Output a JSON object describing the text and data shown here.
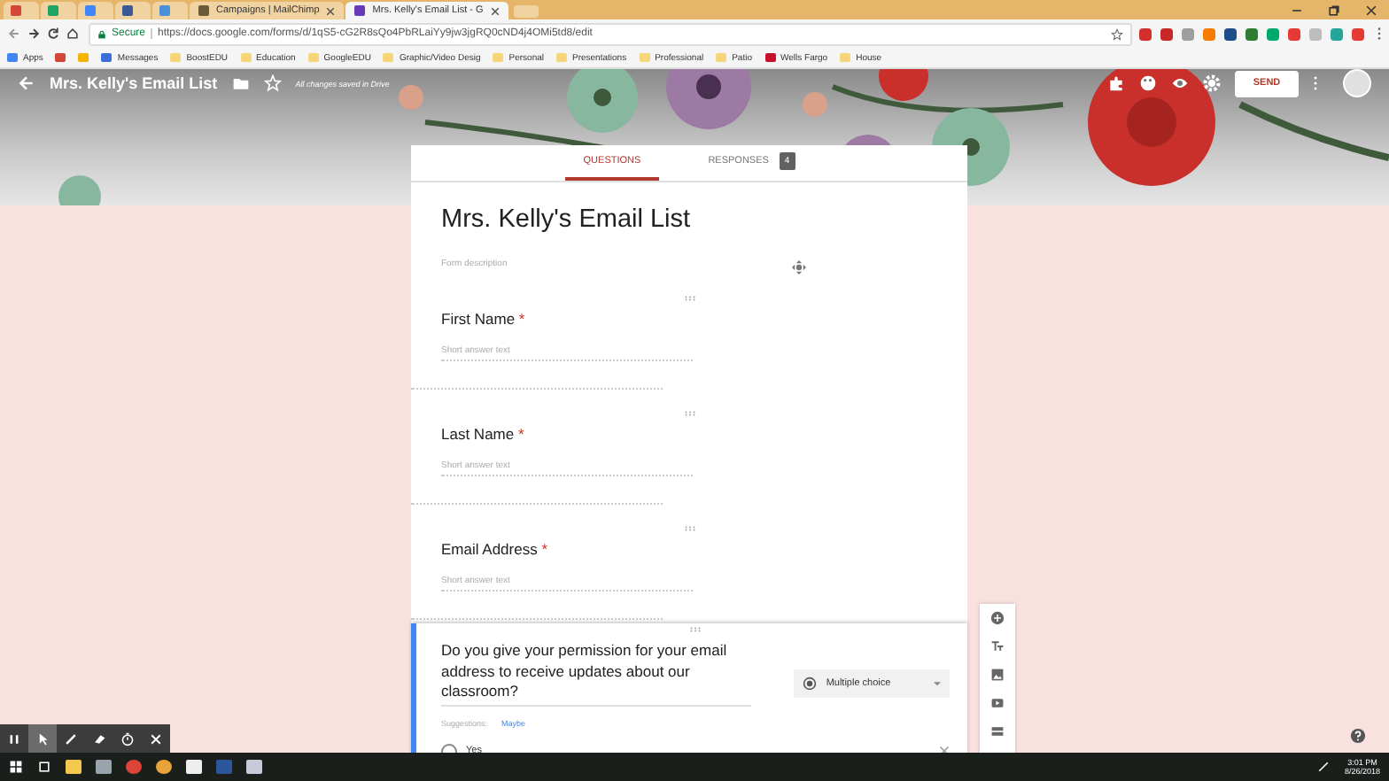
{
  "browser": {
    "tabs": [
      {
        "selected": false,
        "kind": "gmail"
      },
      {
        "selected": false,
        "kind": "drive"
      },
      {
        "selected": false,
        "kind": "calendar"
      },
      {
        "selected": false,
        "kind": "facebook"
      },
      {
        "selected": false,
        "kind": "circle"
      },
      {
        "selected": false,
        "kind": "mailchimp",
        "label": "Campaigns | MailChimp"
      },
      {
        "selected": true,
        "kind": "forms",
        "label": "Mrs. Kelly's Email List - G"
      }
    ],
    "secure_label": "Secure",
    "url": "https://docs.google.com/forms/d/1qS5-cG2R8sQo4PbRLaiYy9jw3jgRQ0cND4j4OMi5td8/edit",
    "bookmarks": [
      {
        "kind": "apps",
        "label": "Apps"
      },
      {
        "kind": "gmail"
      },
      {
        "kind": "drive"
      },
      {
        "kind": "site",
        "label": "Messages"
      },
      {
        "kind": "folder",
        "label": "BoostEDU"
      },
      {
        "kind": "folder",
        "label": "Education"
      },
      {
        "kind": "folder",
        "label": "GoogleEDU"
      },
      {
        "kind": "folder",
        "label": "Graphic/Video Desig"
      },
      {
        "kind": "folder",
        "label": "Personal"
      },
      {
        "kind": "folder",
        "label": "Presentations"
      },
      {
        "kind": "folder",
        "label": "Professional"
      },
      {
        "kind": "folder",
        "label": "Patio"
      },
      {
        "kind": "bank",
        "label": "Wells Fargo"
      },
      {
        "kind": "folder",
        "label": "House"
      }
    ]
  },
  "header": {
    "title": "Mrs. Kelly's Email List",
    "save_status": "All changes saved in Drive",
    "send_label": "SEND"
  },
  "form_tabs": [
    {
      "label": "QUESTIONS",
      "selected": true
    },
    {
      "label": "RESPONSES",
      "selected": false,
      "badge": "4"
    }
  ],
  "form": {
    "title": "Mrs. Kelly's Email List",
    "description_placeholder": "Form description",
    "questions": [
      {
        "kind": "short",
        "title": "First Name",
        "required_mark": "*",
        "placeholder": "Short answer text",
        "active": false
      },
      {
        "kind": "short",
        "title": "Last Name",
        "required_mark": "*",
        "placeholder": "Short answer text",
        "active": false
      },
      {
        "kind": "short",
        "title": "Email Address",
        "required_mark": "*",
        "placeholder": "Short answer text",
        "active": false
      },
      {
        "kind": "choice",
        "title": "Do you give your permission for your email address to receive updates about our classroom?",
        "active": true,
        "type_label": "Multiple choice",
        "suggestions_label": "Suggestions:",
        "suggestion": "Maybe",
        "options": [
          "Yes"
        ]
      }
    ]
  },
  "taskbar": {
    "time": "3:01 PM",
    "date": "8/26/2018"
  }
}
